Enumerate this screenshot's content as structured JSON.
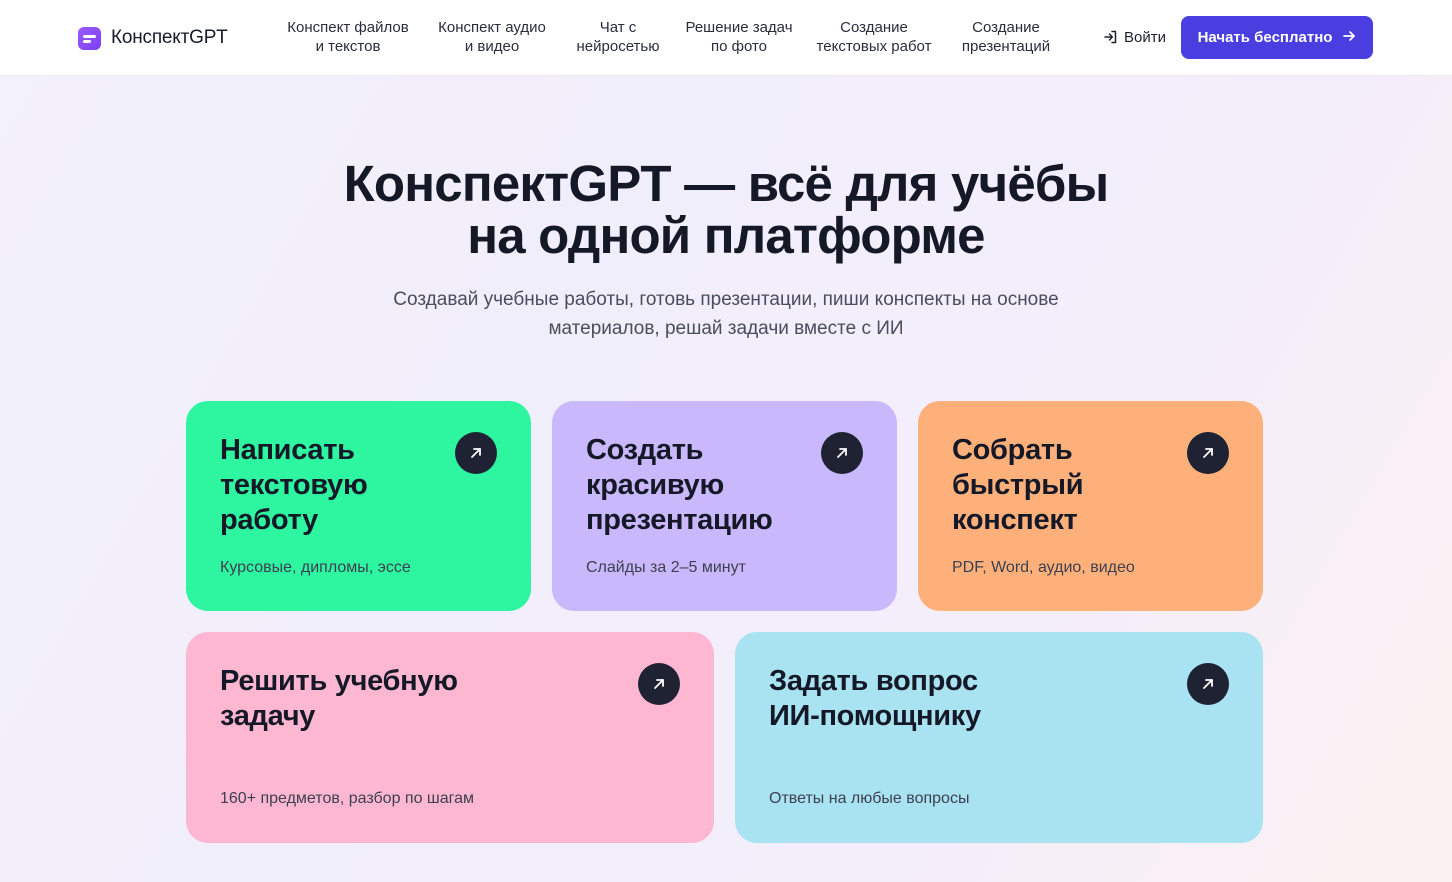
{
  "header": {
    "logo_text": "КонспектGPT",
    "nav": [
      {
        "label": "Конспект файлов\nи текстов"
      },
      {
        "label": "Конспект аудио\nи видео"
      },
      {
        "label": "Чат с\nнейросетью"
      },
      {
        "label": "Решение задач\nпо фото"
      },
      {
        "label": "Создание\nтекстовых работ"
      },
      {
        "label": "Создание\nпрезентаций"
      }
    ],
    "login_label": "Войти",
    "cta_label": "Начать бесплатно"
  },
  "hero": {
    "title": "КонспектGPT — всё для учёбы\nна одной платформе",
    "subtitle": "Создавай учебные работы, готовь презентации, пиши конспекты на основе\nматериалов, решай задачи вместе с ИИ"
  },
  "cards": [
    {
      "title": "Написать\nтекстовую\nработу",
      "subtitle": "Курсовые, дипломы, эссе",
      "color": "#2ef5a0"
    },
    {
      "title": "Создать\nкрасивую\nпрезентацию",
      "subtitle": "Слайды за 2–5 минут",
      "color": "#c9b9fc"
    },
    {
      "title": "Собрать\nбыстрый\nконспект",
      "subtitle": "PDF, Word, аудио, видео",
      "color": "#feb07a"
    },
    {
      "title": "Решить учебную\nзадачу",
      "subtitle": "160+ предметов, разбор по шагам",
      "color": "#feb7d0"
    },
    {
      "title": "Задать вопрос\nИИ-помощнику",
      "subtitle": "Ответы на любые вопросы",
      "color": "#a9e3f1"
    }
  ],
  "icons": {
    "card_action": "arrow-up-right-icon",
    "login": "login-icon",
    "cta": "arrow-right-icon",
    "logo": "logo-icon"
  },
  "colors": {
    "accent": "#4a3ee0",
    "dark_button": "#1e2233"
  }
}
